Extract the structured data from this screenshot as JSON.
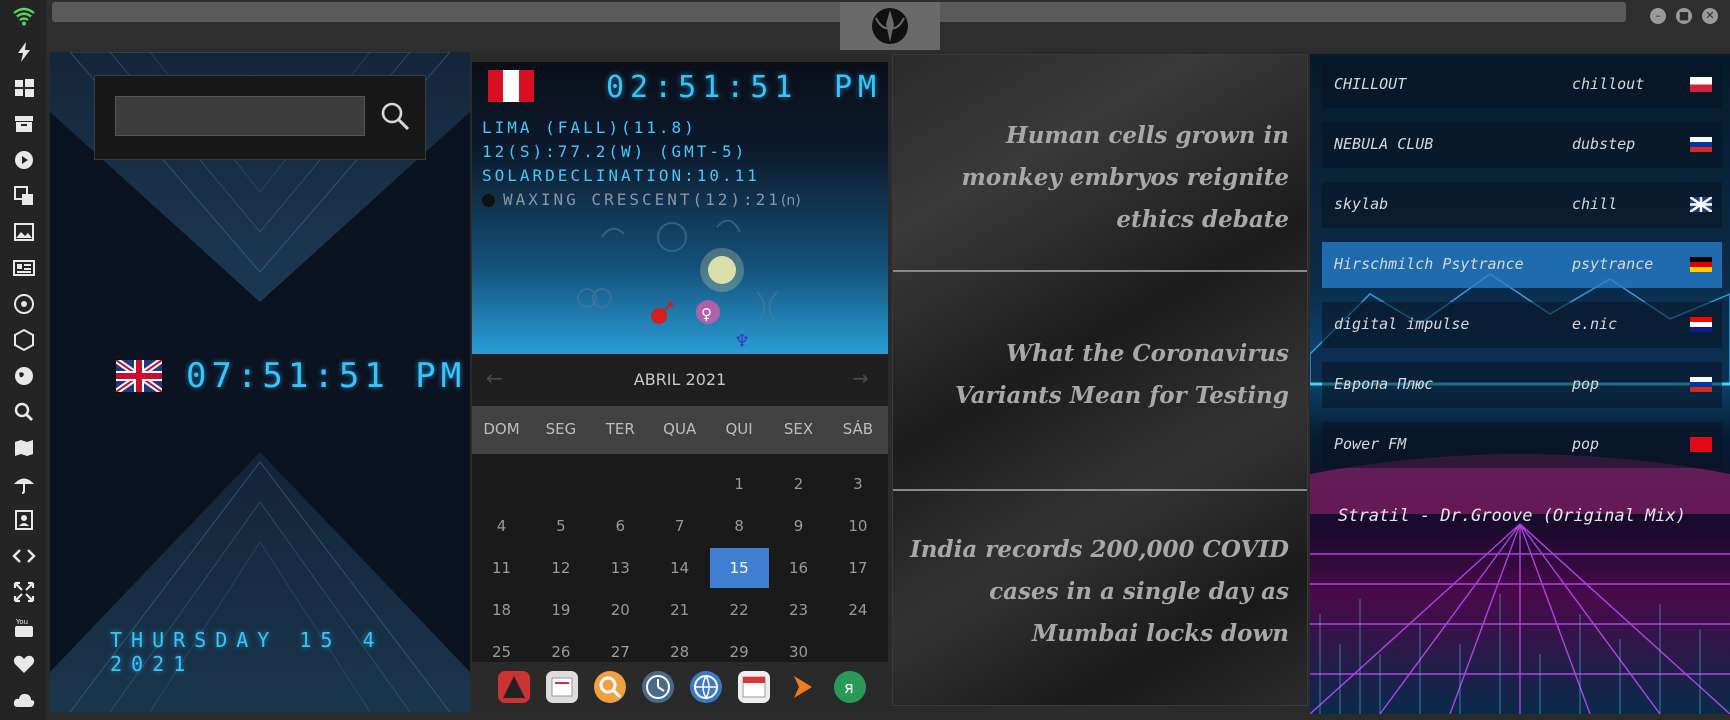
{
  "window": {
    "emblem": "rebel-alliance-icon",
    "controls": [
      "minimize",
      "maximize",
      "close"
    ]
  },
  "sidebar": {
    "items": [
      {
        "icon": "wifi-icon"
      },
      {
        "icon": "lightning-icon"
      },
      {
        "icon": "windows-icon"
      },
      {
        "icon": "archive-icon"
      },
      {
        "icon": "play-icon"
      },
      {
        "icon": "translate-icon"
      },
      {
        "icon": "image-icon"
      },
      {
        "icon": "news-icon"
      },
      {
        "icon": "settings-icon"
      },
      {
        "icon": "hexagon-icon"
      },
      {
        "icon": "globe-icon"
      },
      {
        "icon": "search-icon"
      },
      {
        "icon": "map-icon"
      },
      {
        "icon": "umbrella-icon"
      },
      {
        "icon": "contacts-icon"
      },
      {
        "icon": "code-icon"
      },
      {
        "icon": "expand-icon"
      },
      {
        "icon": "youtube-icon"
      },
      {
        "icon": "heart-icon"
      },
      {
        "icon": "cloud-icon"
      }
    ]
  },
  "search": {
    "value": "",
    "button_icon": "search-icon"
  },
  "local_clock": {
    "flag": "uk-flag",
    "time": "07:51:51 PM",
    "date": "THURSDAY 15 4 2021"
  },
  "world_clock": {
    "flag": "peru-flag",
    "time": "02:51:51",
    "ampm": "PM",
    "location": "LIMA (FALL)(11.8)",
    "coords": "12(S):77.2(W) (GMT-5)",
    "solar": "SOLARDECLINATION:10.11",
    "moon": "WAXING CRESCENT(12):21",
    "moon_suffix": "(n)"
  },
  "calendar": {
    "month": "ABRIL 2021",
    "prev": "←",
    "next": "→",
    "weekdays": [
      "DOM",
      "SEG",
      "TER",
      "QUA",
      "QUI",
      "SEX",
      "SÁB"
    ],
    "days": [
      1,
      2,
      3,
      4,
      5,
      6,
      7,
      8,
      9,
      10,
      11,
      12,
      13,
      14,
      15,
      16,
      17,
      18,
      19,
      20,
      21,
      22,
      23,
      24,
      25,
      26,
      27,
      28,
      29,
      30
    ],
    "first_weekday": 4,
    "selected": 15
  },
  "dock": [
    "launcher-icon",
    "notes-icon",
    "search-app-icon",
    "clock-app-icon",
    "browser-icon",
    "calendar-app-icon",
    "play-app-icon",
    "yandex-icon"
  ],
  "news": [
    "Human cells grown in monkey embryos reignite ethics debate",
    "What the Coronavirus Variants Mean for Testing",
    "India records 200,000 COVID cases in a single day as Mumbai locks down"
  ],
  "radio": {
    "stations": [
      {
        "name": "CHILLOUT",
        "genre": "chillout",
        "flag": "poland-flag"
      },
      {
        "name": "NEBULA CLUB",
        "genre": "dubstep",
        "flag": "russia-flag"
      },
      {
        "name": "skylab",
        "genre": "chill",
        "flag": "uk-flag"
      },
      {
        "name": "Hirschmilch Psytrance",
        "genre": "psytrance",
        "flag": "germany-flag"
      },
      {
        "name": "digital impulse",
        "genre": "e.nic",
        "flag": "croatia-flag"
      },
      {
        "name": "Европа Плюс",
        "genre": "pop",
        "flag": "russia-flag"
      },
      {
        "name": "Power FM",
        "genre": "pop",
        "flag": "turkey-flag"
      }
    ],
    "active_index": 3,
    "now_playing": "Stratil - Dr.Groove (Original Mix)"
  },
  "colors": {
    "digital": "#35c6ff",
    "selected_day": "#3f7fd1",
    "active_station": "#2882d2"
  }
}
